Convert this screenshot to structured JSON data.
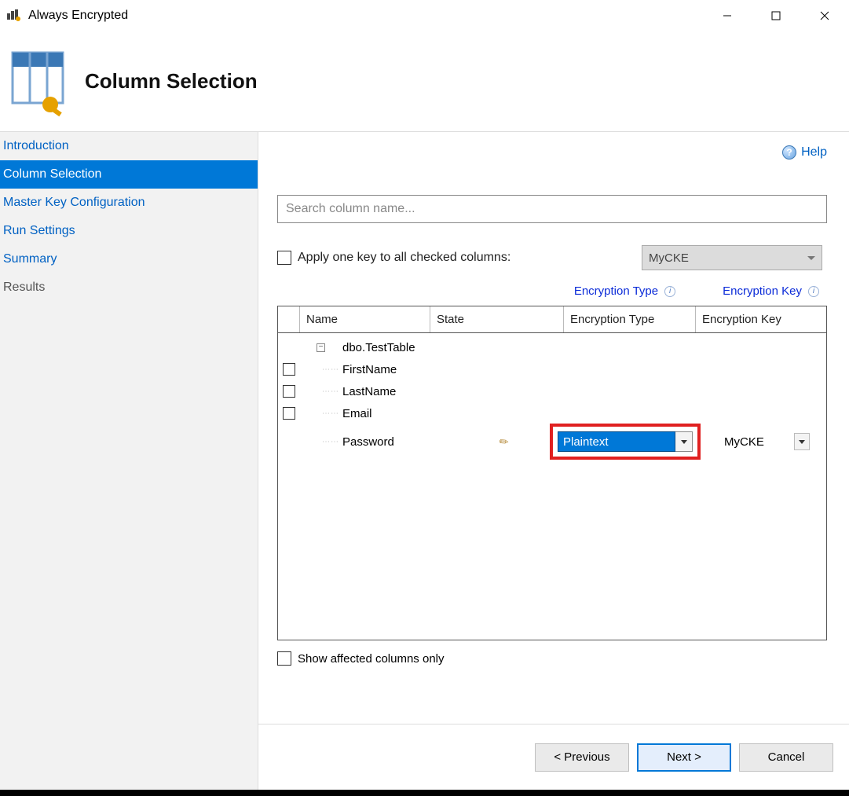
{
  "titlebar": {
    "title": "Always Encrypted"
  },
  "header": {
    "title": "Column Selection"
  },
  "sidebar": {
    "items": [
      {
        "label": "Introduction",
        "state": "past"
      },
      {
        "label": "Column Selection",
        "state": "active"
      },
      {
        "label": "Master Key Configuration",
        "state": "past"
      },
      {
        "label": "Run Settings",
        "state": "past"
      },
      {
        "label": "Summary",
        "state": "past"
      },
      {
        "label": "Results",
        "state": "disabled"
      }
    ]
  },
  "main": {
    "help_label": "Help",
    "search_placeholder": "Search column name...",
    "apply_label": "Apply one key to all checked columns:",
    "apply_key_value": "MyCKE",
    "legend_enc_type": "Encryption Type",
    "legend_enc_key": "Encryption Key",
    "grid": {
      "headers": {
        "name": "Name",
        "state": "State",
        "enc_type": "Encryption Type",
        "enc_key": "Encryption Key"
      },
      "table_name": "dbo.TestTable",
      "rows": [
        {
          "name": "FirstName"
        },
        {
          "name": "LastName"
        },
        {
          "name": "Email"
        },
        {
          "name": "Password",
          "enc_type_value": "Plaintext",
          "enc_key_value": "MyCKE",
          "edited": true
        }
      ]
    },
    "affected_label": "Show affected columns only"
  },
  "footer": {
    "previous": "< Previous",
    "next": "Next >",
    "cancel": "Cancel"
  }
}
